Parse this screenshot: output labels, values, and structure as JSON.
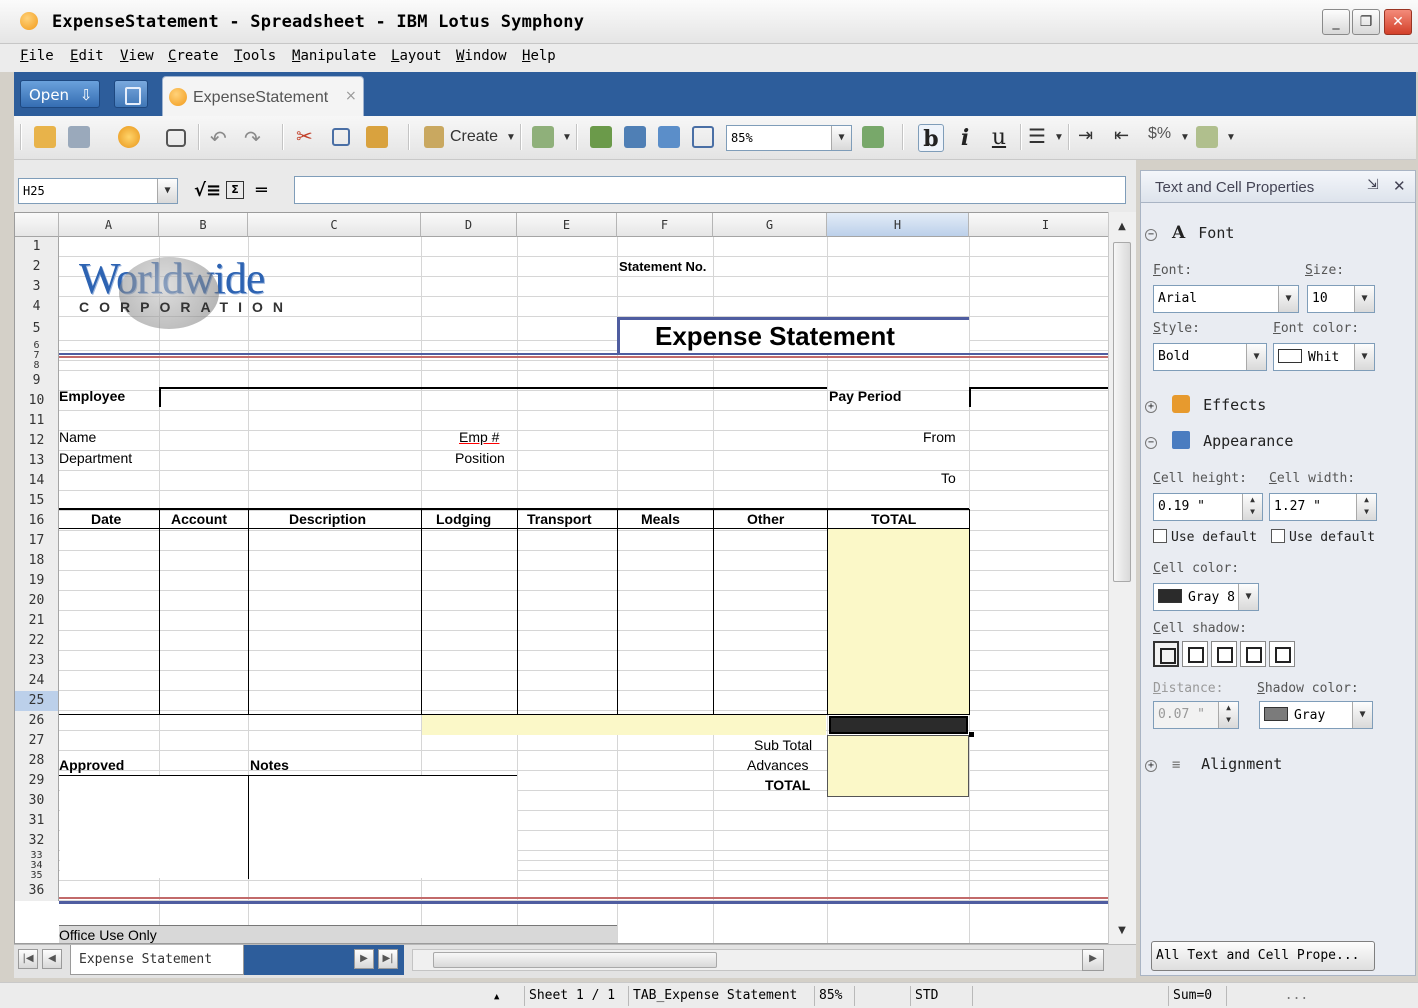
{
  "window": {
    "title": "ExpenseStatement - Spreadsheet - IBM Lotus Symphony",
    "minimize": "_",
    "restore": "❐",
    "close": "✕"
  },
  "menu": [
    "File",
    "Edit",
    "View",
    "Create",
    "Tools",
    "Manipulate",
    "Layout",
    "Window",
    "Help"
  ],
  "tabbar": {
    "open_label": "Open",
    "doc_tab_label": "ExpenseStatement",
    "doc_tab_close": "×"
  },
  "toolbar": {
    "create_label": "Create",
    "zoom_value": "85%",
    "bold": "b",
    "italic": "i",
    "underline": "u"
  },
  "formula_bar": {
    "name_box": "H25",
    "formula": ""
  },
  "sheet": {
    "columns": [
      "A",
      "B",
      "C",
      "D",
      "E",
      "F",
      "G",
      "H",
      "I"
    ],
    "selected_column": "H",
    "selected_row": "25",
    "rows": [
      "1",
      "2",
      "3",
      "4",
      "5",
      "6",
      "7",
      "8",
      "9",
      "10",
      "11",
      "12",
      "13",
      "14",
      "15",
      "16",
      "17",
      "18",
      "19",
      "20",
      "21",
      "22",
      "23",
      "24",
      "25",
      "26",
      "27",
      "28",
      "29",
      "30",
      "31",
      "32",
      "33",
      "34",
      "35",
      "36"
    ],
    "logo_main": "Worldwide",
    "logo_sub": "CORPORATION",
    "statement_no": "Statement No.",
    "heading": "Expense Statement",
    "employee": "Employee",
    "pay_period": "Pay Period",
    "name": "Name",
    "department": "Department",
    "emp_no": "Emp #",
    "position": "Position",
    "from": "From",
    "to": "To",
    "table_headers": [
      "Date",
      "Account",
      "Description",
      "Lodging",
      "Transport",
      "Meals",
      "Other",
      "TOTAL"
    ],
    "sub_total": "Sub Total",
    "advances": "Advances",
    "total": "TOTAL",
    "approved": "Approved",
    "notes": "Notes",
    "office_use": "Office Use Only"
  },
  "sheet_tabs": {
    "active": "Expense Statement"
  },
  "status": {
    "sheet": "Sheet 1 / 1",
    "page_style": "TAB_Expense Statement",
    "zoom": "85%",
    "mode": "STD",
    "sum": "Sum=0",
    "dots": "..."
  },
  "sidebar": {
    "title": "Text and Cell Properties",
    "font_section": "Font",
    "font_label": "Font:",
    "size_label": "Size:",
    "font_value": "Arial",
    "size_value": "10",
    "style_label": "Style:",
    "font_color_label": "Font color:",
    "style_value": "Bold",
    "font_color_value": "Whit",
    "effects_section": "Effects",
    "appearance_section": "Appearance",
    "cell_height_label": "Cell height:",
    "cell_width_label": "Cell width:",
    "cell_height_value": "0.19 \"",
    "cell_width_value": "1.27 \"",
    "use_default_1": "Use default",
    "use_default_2": "Use default",
    "cell_color_label": "Cell color:",
    "cell_color_value": "Gray 8",
    "cell_shadow_label": "Cell shadow:",
    "distance_label": "Distance:",
    "distance_value": "0.07 \"",
    "shadow_color_label": "Shadow color:",
    "shadow_color_value": "Gray",
    "alignment_section": "Alignment",
    "footer_button": "All Text and Cell Prope..."
  },
  "colors": {
    "tabbar_blue": "#2d5d9b",
    "highlight_yellow": "#fbf8c8",
    "selection_blue": "#bcd0ea"
  }
}
